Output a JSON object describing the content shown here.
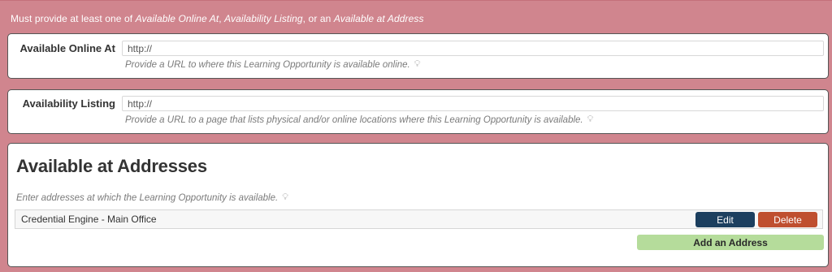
{
  "notice": {
    "prefix": "Must provide at least one of ",
    "item1": "Available Online At",
    "sep1": ", ",
    "item2": "Availability Listing",
    "sep2": ", or an ",
    "item3": "Available at Address"
  },
  "online": {
    "label": "Available Online At",
    "placeholder": "http://",
    "value": "",
    "help": "Provide a URL to where this Learning Opportunity is available online."
  },
  "listing": {
    "label": "Availability Listing",
    "placeholder": "http://",
    "value": "",
    "help": "Provide a URL to a page that lists physical and/or online locations where this Learning Opportunity is available."
  },
  "addresses": {
    "title": "Available at Addresses",
    "help": "Enter addresses at which the Learning Opportunity is available.",
    "items": [
      {
        "name": "Credential Engine - Main Office",
        "edit_label": "Edit",
        "delete_label": "Delete"
      }
    ],
    "add_label": "Add an Address"
  },
  "icons": {
    "hint": "hint-icon"
  },
  "colors": {
    "error_background": "#d0858e",
    "edit_button": "#1c3f5f",
    "delete_button": "#bf4f2f",
    "add_button": "#b5dc9b"
  }
}
